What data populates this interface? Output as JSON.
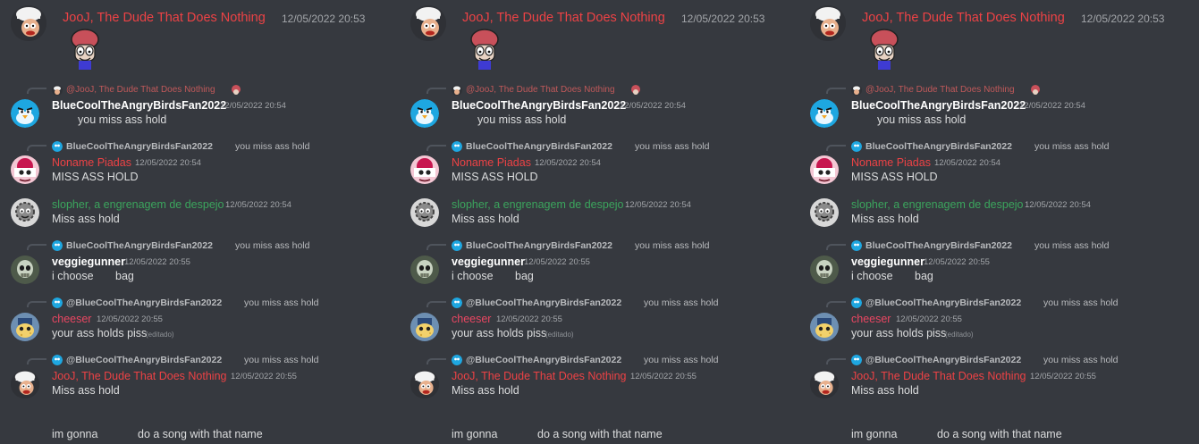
{
  "colors": {
    "background": "#36393f",
    "red_name": "#ed4245",
    "green_name": "#3ba55d",
    "pink_name": "#ea4662",
    "timestamp": "#a3a6aa",
    "message": "#dcddde"
  },
  "chat": {
    "first": {
      "author": "JooJ, The Dude That Does Nothing",
      "timestamp": "12/05/2022 20:53",
      "attachment_icon": "mushroom-guy-emoji"
    },
    "m1": {
      "reply_author": "@JooJ, The Dude That Does Nothing",
      "author": "BlueCoolTheAngryBirdsFan2022",
      "timestamp": "12/05/2022 20:54",
      "text": "you miss ass hold"
    },
    "m2": {
      "reply_author": "BlueCoolTheAngryBirdsFan2022",
      "reply_text": "you miss ass hold",
      "author": "Noname Piadas",
      "timestamp": "12/05/2022 20:54",
      "text": "MISS ASS HOLD"
    },
    "m3": {
      "author": "slopher, a engrenagem de despejo",
      "timestamp": "12/05/2022 20:54",
      "text": "Miss ass hold"
    },
    "m4": {
      "reply_author": "BlueCoolTheAngryBirdsFan2022",
      "reply_text": "you miss ass hold",
      "author": "veggiegunner",
      "timestamp": "12/05/2022 20:55",
      "text_a": "i choose",
      "text_b": "bag"
    },
    "m5": {
      "reply_author": "@BlueCoolTheAngryBirdsFan2022",
      "reply_text": "you miss ass hold",
      "author": "cheeser",
      "timestamp": "12/05/2022 20:55",
      "text": "your ass holds piss",
      "edited": "(editado)"
    },
    "m6": {
      "reply_author": "@BlueCoolTheAngryBirdsFan2022",
      "reply_text": "you miss ass hold",
      "author": "JooJ, The Dude That Does Nothing",
      "timestamp": "12/05/2022 20:55",
      "text": "Miss ass hold"
    },
    "m7": {
      "text_a": "im gonna",
      "text_b": "do a song with that name"
    }
  }
}
